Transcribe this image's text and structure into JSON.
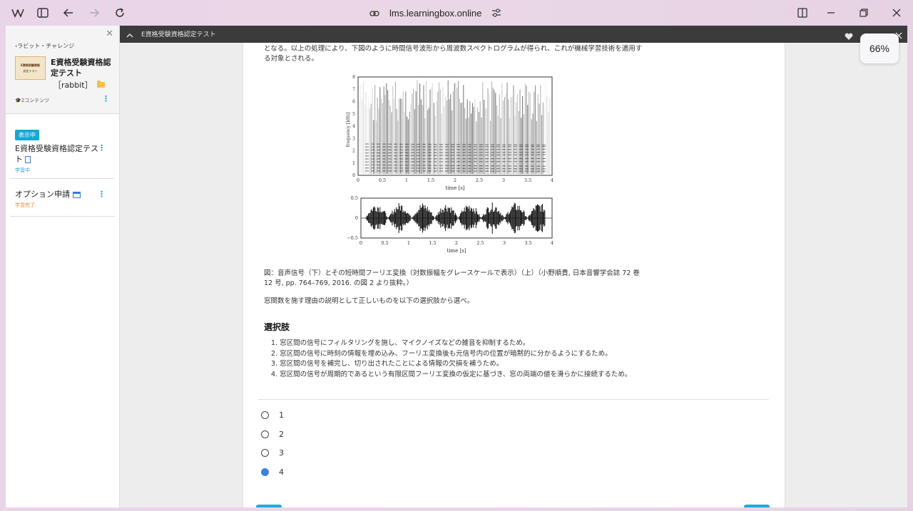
{
  "browser": {
    "url": "lms.learningbox.online",
    "zoom": "66%"
  },
  "sidebar": {
    "back_label": "ラビット・チャレンジ",
    "thumb_line1": "E資格受験資格",
    "thumb_line2": "認定テスト",
    "course_title": "E資格受験資格認定テスト",
    "course_sub": "［rabbit］",
    "content_count": "2コンテンツ",
    "items": [
      {
        "badge": "表示中",
        "title": "E資格受験資格認定テスト",
        "status": "学習中",
        "status_color": "#1aa3d9"
      },
      {
        "title": "オプション申請",
        "status": "学習完了",
        "status_color": "#f08a24"
      }
    ]
  },
  "darkbar": {
    "title": "E資格受験資格認定テスト"
  },
  "content": {
    "intro_line1": "となる。以上の処理により、下図のように時間信号波形から周波数スペクトログラムが得られ、これが機械学習技術を適用す",
    "intro_line2": "る対象とされる。",
    "caption_line1": "図：音声信号（下）とその短時間フーリエ変換（対数振幅をグレースケールで表示）（上）（小野順貴, 日本音響学会誌 72 巻",
    "caption_line2": "12 号, pp. 764–769, 2016. の図 2 より抜粋。）",
    "question": "窓関数を施す理由の説明として正しいものを以下の選択肢から選べ。",
    "choices_heading": "選択肢",
    "choices": [
      "1. 窓区間の信号にフィルタリングを施し、マイクノイズなどの雑音を抑制するため。",
      "2. 窓区間の信号に時刻の情報を埋め込み、フーリエ変換後も元信号内の位置が暗黙的に分かるようにするため。",
      "3. 窓区間の信号を補完し、切り出されたことによる情報の欠損を補うため。",
      "4. 窓区間の信号が周期的であるという有限区間フーリエ変換の仮定に基づき、窓の両端の値を滑らかに接続するため。"
    ],
    "options": [
      "1",
      "2",
      "3",
      "4"
    ],
    "selected": "4"
  },
  "figure": {
    "spec_ylabel": "frequency [kHz]",
    "spec_yticks": [
      "8",
      "7",
      "6",
      "5",
      "4",
      "3",
      "2",
      "1",
      "0"
    ],
    "xticks": [
      "0",
      "0.5",
      "1",
      "1.5",
      "2",
      "2.5",
      "3",
      "3.5",
      "4"
    ],
    "xlabel": "time [s]",
    "wave_yticks": [
      "0.5",
      "0",
      "−0.5"
    ]
  }
}
